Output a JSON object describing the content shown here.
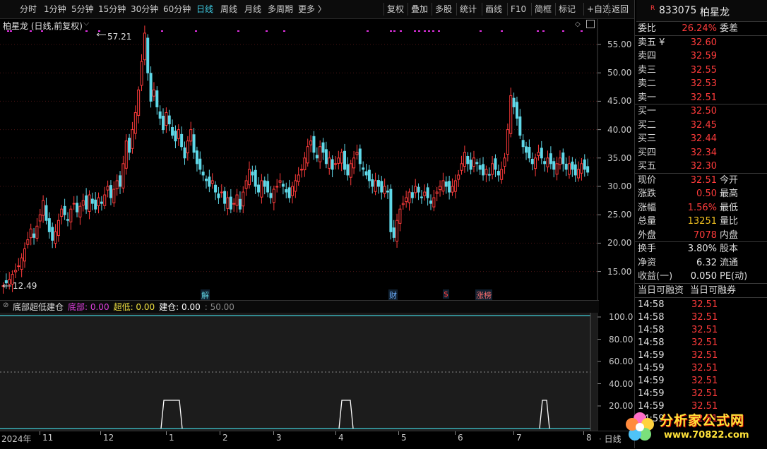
{
  "toolbar": {
    "periods": [
      "分时",
      "1分钟",
      "5分钟",
      "15分钟",
      "30分钟",
      "60分钟",
      "日线",
      "周线",
      "月线",
      "多周期",
      "更多 〉"
    ],
    "active_period": "日线",
    "tools": [
      "复权",
      "叠加",
      "多股",
      "统计",
      "画线",
      "F10",
      "简框",
      "标记",
      "+自选",
      "返回"
    ]
  },
  "stock": {
    "code_badge": "R",
    "code": "833075",
    "name": "柏星龙"
  },
  "main_chart": {
    "title": "柏星龙 (日线,前复权)",
    "high_label": "57.21",
    "low_label": "12.49",
    "y_ticks": [
      "55.00",
      "50.00",
      "45.00",
      "40.00",
      "35.00",
      "30.00",
      "25.00",
      "20.00",
      "15.00"
    ],
    "markers": [
      {
        "label": "解",
        "color": "#5fd0e0"
      },
      {
        "label": "财",
        "color": "#6fb0ff"
      },
      {
        "label": "$",
        "color": "#ff4040"
      },
      {
        "label": "涨榜",
        "color": "#ff7070"
      }
    ]
  },
  "indicator": {
    "name": "底部超低建仓",
    "items": [
      {
        "label": "底部:",
        "value": "0.00",
        "color": "#e040e0"
      },
      {
        "label": "超低:",
        "value": "0.00",
        "color": "#f0e040"
      },
      {
        "label": "建仓:",
        "value": "0.00",
        "color": "#ffffff"
      }
    ],
    "extra": ": 50.00",
    "y_ticks": [
      "100.0",
      "80.00",
      "60.00",
      "40.00",
      "20.00"
    ]
  },
  "x_axis": {
    "labels": [
      "2024年",
      "11",
      "12",
      "1",
      "2",
      "3",
      "4",
      "5",
      "6",
      "7",
      "8"
    ],
    "right_label": "日线"
  },
  "order_book": {
    "wei_bi": {
      "label": "委比",
      "value": "26.24%",
      "right": "委差"
    },
    "asks": [
      {
        "label": "卖五 ¥",
        "price": "32.60"
      },
      {
        "label": "卖四",
        "price": "32.59"
      },
      {
        "label": "卖三",
        "price": "32.55"
      },
      {
        "label": "卖二",
        "price": "32.53"
      },
      {
        "label": "卖一",
        "price": "32.51"
      }
    ],
    "bids": [
      {
        "label": "买一",
        "price": "32.50"
      },
      {
        "label": "买二",
        "price": "32.45"
      },
      {
        "label": "买三",
        "price": "32.44"
      },
      {
        "label": "买四",
        "price": "32.34"
      },
      {
        "label": "买五",
        "price": "32.30"
      }
    ]
  },
  "quote": [
    {
      "label": "现价",
      "value": "32.51",
      "right": "今开",
      "color": "#ff3b3b"
    },
    {
      "label": "涨跌",
      "value": "0.50",
      "right": "最高",
      "color": "#ff3b3b"
    },
    {
      "label": "涨幅",
      "value": "1.56%",
      "right": "最低",
      "color": "#ff3b3b"
    },
    {
      "label": "总量",
      "value": "13251",
      "right": "量比",
      "color": "#f0c020"
    },
    {
      "label": "外盘",
      "value": "7078",
      "right": "内盘",
      "color": "#ff3b3b"
    },
    {
      "label": "换手",
      "value": "3.80%",
      "right": "股本",
      "color": "#e6e6e6"
    },
    {
      "label": "净资",
      "value": "6.32",
      "right": "流通",
      "color": "#e6e6e6"
    },
    {
      "label": "收益(一)",
      "value": "0.050",
      "right": "PE(动)",
      "color": "#e6e6e6"
    }
  ],
  "margin": {
    "left": "当日可融资",
    "right": "当日可融券"
  },
  "ticks": [
    {
      "time": "14:58",
      "price": "32.51"
    },
    {
      "time": "14:58",
      "price": "32.51"
    },
    {
      "time": "14:58",
      "price": "32.51"
    },
    {
      "time": "14:58",
      "price": "32.51"
    },
    {
      "time": "14:59",
      "price": "32.51"
    },
    {
      "time": "14:59",
      "price": "32.51"
    },
    {
      "time": "14:59",
      "price": "32.51"
    },
    {
      "time": "14:59",
      "price": "32.51"
    },
    {
      "time": "14:59",
      "price": "32.51"
    },
    {
      "time": "14:59",
      "price": "32.51"
    }
  ],
  "watermark": {
    "text": "分析家公式网",
    "url": "www.70822.com"
  },
  "colors": {
    "up": "#ff3b3b",
    "down": "#5fd8e8",
    "grid": "#5a1a1a"
  }
}
